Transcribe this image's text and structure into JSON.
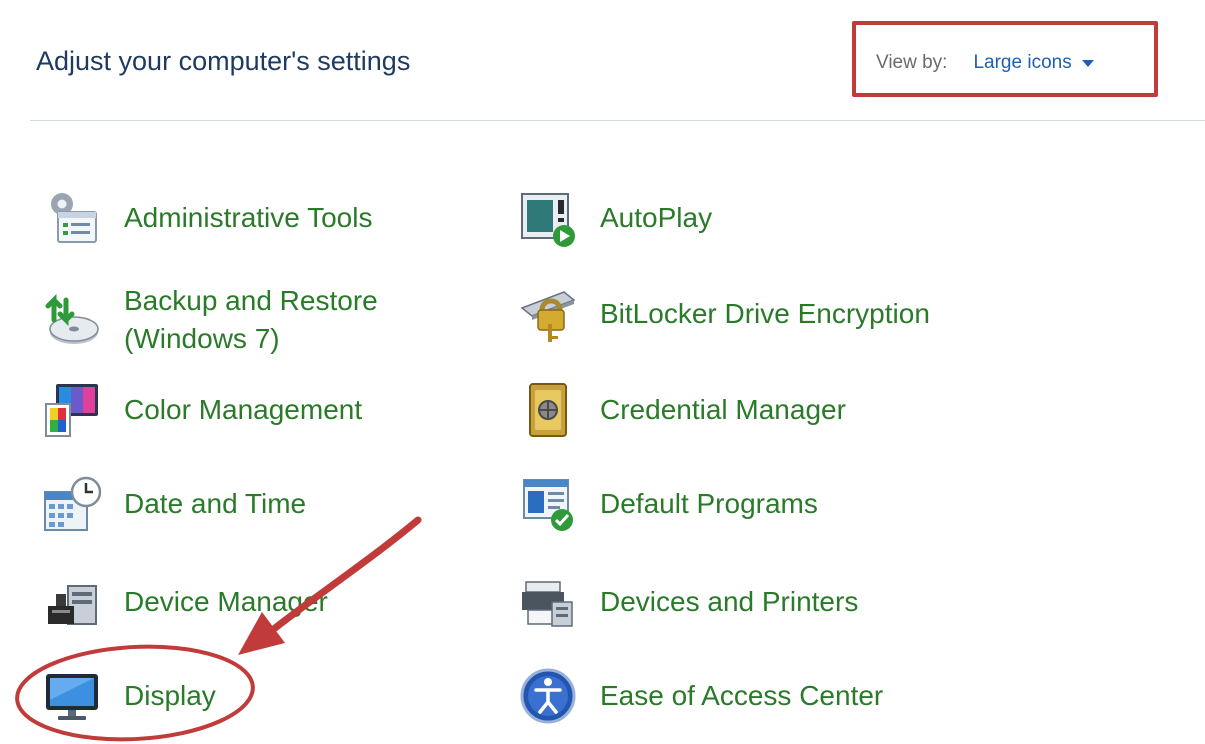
{
  "page": {
    "title": "Adjust your computer's settings"
  },
  "view_by": {
    "label": "View by:",
    "selected": "Large icons"
  },
  "colors": {
    "title": "#1e3a5f",
    "link": "#2a7a2a",
    "view_by_value": "#1e5fb0",
    "annotation": "#c23b3b"
  },
  "items": [
    {
      "id": "administrative-tools",
      "icon": "administrative-tools-icon",
      "lines": [
        "Administrative Tools"
      ]
    },
    {
      "id": "autoplay",
      "icon": "autoplay-icon",
      "lines": [
        "AutoPlay"
      ]
    },
    {
      "id": "backup-and-restore",
      "icon": "backup-and-restore-icon",
      "lines": [
        "Backup and Restore",
        "(Windows 7)"
      ]
    },
    {
      "id": "bitlocker-drive-encryption",
      "icon": "bitlocker-icon",
      "lines": [
        "BitLocker Drive Encryption"
      ]
    },
    {
      "id": "color-management",
      "icon": "color-management-icon",
      "lines": [
        "Color Management"
      ]
    },
    {
      "id": "credential-manager",
      "icon": "credential-manager-icon",
      "lines": [
        "Credential Manager"
      ]
    },
    {
      "id": "date-and-time",
      "icon": "date-and-time-icon",
      "lines": [
        "Date and Time"
      ]
    },
    {
      "id": "default-programs",
      "icon": "default-programs-icon",
      "lines": [
        "Default Programs"
      ]
    },
    {
      "id": "device-manager",
      "icon": "device-manager-icon",
      "lines": [
        "Device Manager"
      ]
    },
    {
      "id": "devices-and-printers",
      "icon": "devices-and-printers-icon",
      "lines": [
        "Devices and Printers"
      ]
    },
    {
      "id": "display",
      "icon": "display-icon",
      "lines": [
        "Display"
      ]
    },
    {
      "id": "ease-of-access-center",
      "icon": "ease-of-access-icon",
      "lines": [
        "Ease of Access Center"
      ]
    }
  ]
}
